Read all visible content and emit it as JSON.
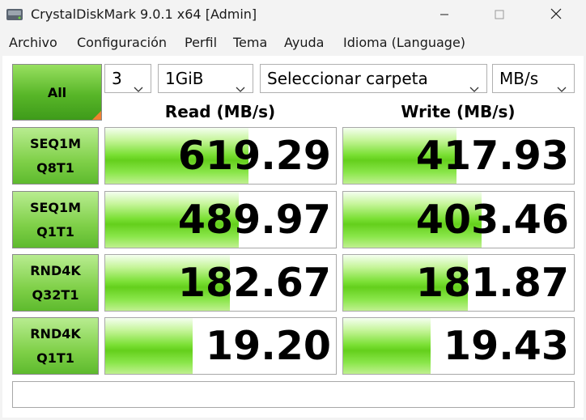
{
  "window": {
    "title": "CrystalDiskMark 9.0.1 x64 [Admin]"
  },
  "menu": [
    "Archivo",
    "Configuración",
    "Perfil",
    "Tema",
    "Ayuda",
    "Idioma (Language)"
  ],
  "toolbar": {
    "all_label": "All",
    "count_value": "3",
    "size_value": "1GiB",
    "folder_value": "Seleccionar carpeta",
    "unit_value": "MB/s"
  },
  "headers": {
    "read": "Read (MB/s)",
    "write": "Write (MB/s)"
  },
  "rows": [
    {
      "line1": "SEQ1M",
      "line2": "Q8T1",
      "read": "619.29",
      "read_fill": 0.62,
      "write": "417.93",
      "write_fill": 0.49
    },
    {
      "line1": "SEQ1M",
      "line2": "Q1T1",
      "read": "489.97",
      "read_fill": 0.58,
      "write": "403.46",
      "write_fill": 0.6
    },
    {
      "line1": "RND4K",
      "line2": "Q32T1",
      "read": "182.67",
      "read_fill": 0.54,
      "write": "181.87",
      "write_fill": 0.54
    },
    {
      "line1": "RND4K",
      "line2": "Q1T1",
      "read": "19.20",
      "read_fill": 0.38,
      "write": "19.43",
      "write_fill": 0.38
    }
  ],
  "comment": "",
  "colors": {
    "accent_green": "#64cf1c",
    "corner_orange": "#f08030"
  },
  "icons": {
    "app": "disk-icon",
    "minimize": "minimize-icon",
    "maximize": "maximize-icon",
    "close": "close-icon",
    "dropdown": "chevron-down-icon"
  }
}
